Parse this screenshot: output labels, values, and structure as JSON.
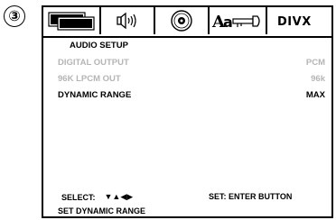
{
  "step_marker": "③",
  "tabs": [
    {
      "name": "general",
      "icon": "monitor-layers-icon"
    },
    {
      "name": "audio",
      "icon": "speaker-icon"
    },
    {
      "name": "disc",
      "icon": "disc-icon"
    },
    {
      "name": "language-lock",
      "icon": "language-key-icon"
    },
    {
      "name": "divx",
      "icon": "divx-logo-icon",
      "logo_text": "DIVX"
    }
  ],
  "menu": {
    "title": "AUDIO SETUP",
    "items": [
      {
        "label": "DIGITAL OUTPUT",
        "value": "PCM",
        "state": "disabled"
      },
      {
        "label": "96K LPCM OUT",
        "value": "96k",
        "state": "disabled"
      },
      {
        "label": "DYNAMIC RANGE",
        "value": "MAX",
        "state": "active"
      }
    ]
  },
  "help": {
    "select_label": "SELECT:",
    "select_arrows": "▼▲◀▶",
    "set_label": "SET: ENTER BUTTON",
    "status": "SET DYNAMIC RANGE"
  },
  "colors": {
    "disabled_text": "#b5b5b5",
    "active_text": "#000000",
    "frame": "#000000"
  }
}
